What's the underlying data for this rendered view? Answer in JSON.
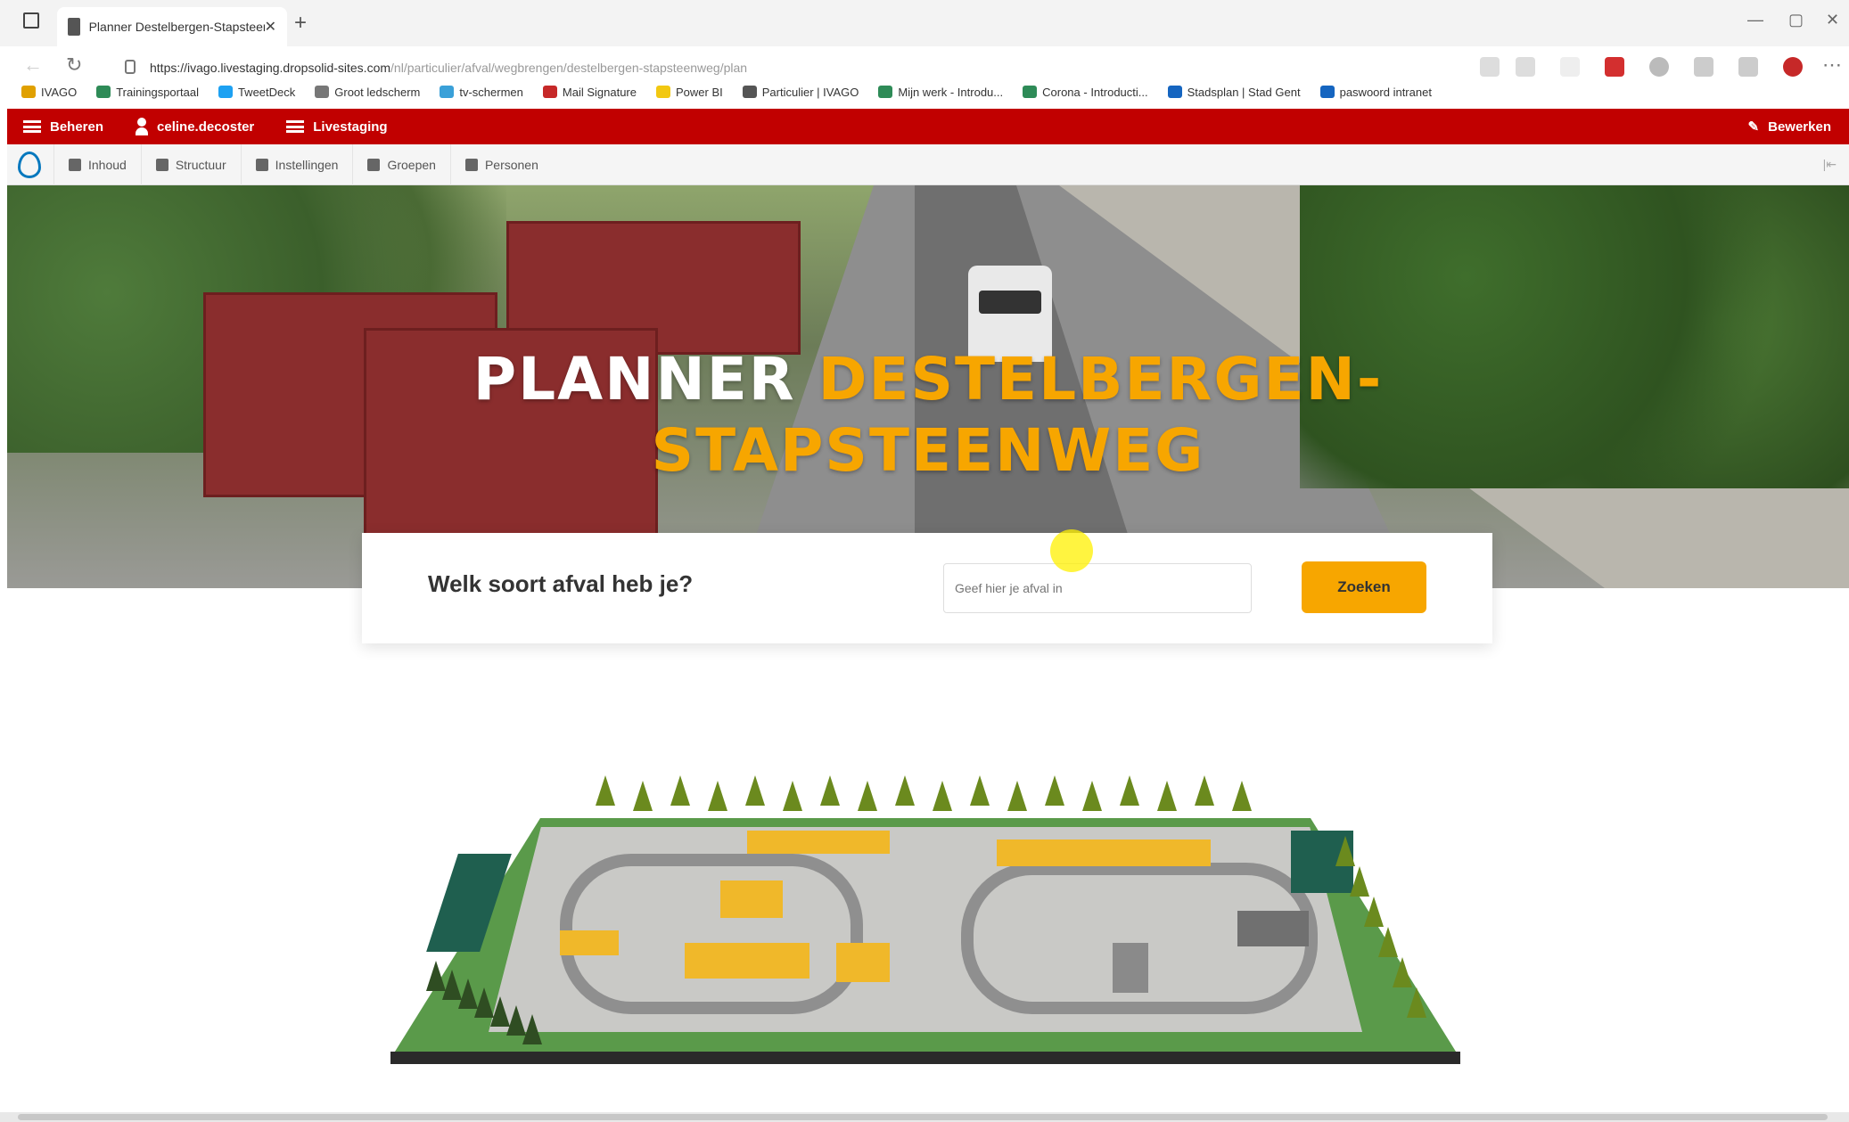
{
  "browser": {
    "tab_title": "Planner Destelbergen-Stapsteen",
    "url_host": "https://ivago.livestaging.dropsolid-sites.com",
    "url_path": "/nl/particulier/afval/wegbrengen/destelbergen-stapsteenweg/plan",
    "bookmarks": [
      {
        "label": "IVAGO",
        "color": "#e0a000"
      },
      {
        "label": "Trainingsportaal",
        "color": "#2e8b57"
      },
      {
        "label": "TweetDeck",
        "color": "#1da1f2"
      },
      {
        "label": "Groot ledscherm",
        "color": "#777777"
      },
      {
        "label": "tv-schermen",
        "color": "#3aa0d8"
      },
      {
        "label": "Mail Signature",
        "color": "#c62828"
      },
      {
        "label": "Power BI",
        "color": "#f2c811"
      },
      {
        "label": "Particulier | IVAGO",
        "color": "#555555"
      },
      {
        "label": "Mijn werk - Introdu...",
        "color": "#2e8b57"
      },
      {
        "label": "Corona - Introducti...",
        "color": "#2e8b57"
      },
      {
        "label": "Stadsplan | Stad Gent",
        "color": "#1565c0"
      },
      {
        "label": "paswoord intranet",
        "color": "#1565c0"
      }
    ]
  },
  "admin": {
    "manage": "Beheren",
    "user": "celine.decoster",
    "environment": "Livestaging",
    "edit": "Bewerken",
    "menu": [
      "Inhoud",
      "Structuur",
      "Instellingen",
      "Groepen",
      "Personen"
    ]
  },
  "hero": {
    "title_white": "PLANNER ",
    "title_orange_1": "DESTELBERGEN-",
    "title_orange_2": "STAPSTEENWEG"
  },
  "search": {
    "question": "Welk soort afval heb je?",
    "placeholder": "Geef hier je afval in",
    "button": "Zoeken"
  },
  "colors": {
    "admin_red": "#c10000",
    "accent_orange": "#f7a600"
  }
}
